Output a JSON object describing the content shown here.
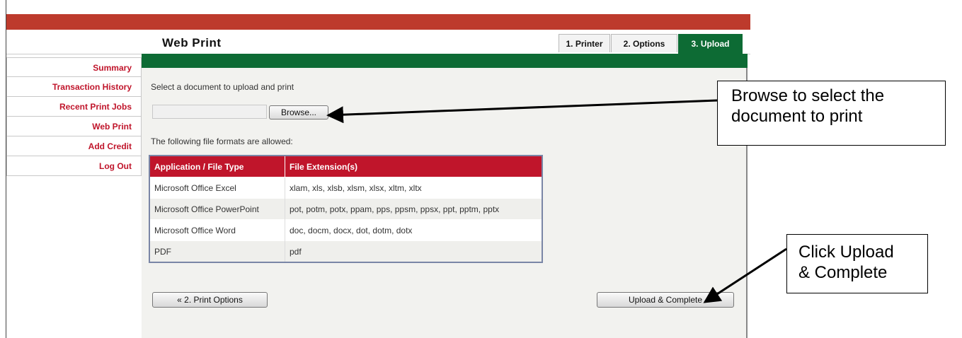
{
  "header": {
    "title": "Web Print",
    "tabs": [
      {
        "label": "1. Printer",
        "active": false
      },
      {
        "label": "2. Options",
        "active": false
      },
      {
        "label": "3. Upload",
        "active": true
      }
    ]
  },
  "sidebar": {
    "items": [
      {
        "label": "Summary"
      },
      {
        "label": "Transaction History"
      },
      {
        "label": "Recent Print Jobs"
      },
      {
        "label": "Web Print"
      },
      {
        "label": "Add Credit"
      },
      {
        "label": "Log Out"
      }
    ]
  },
  "main": {
    "select_prompt": "Select a document to upload and print",
    "browse_label": "Browse...",
    "file_value": "",
    "formats_intro": "The following file formats are allowed:",
    "table": {
      "headers": [
        "Application / File Type",
        "File Extension(s)"
      ],
      "rows": [
        [
          "Microsoft Office Excel",
          "xlam, xls, xlsb, xlsm, xlsx, xltm, xltx"
        ],
        [
          "Microsoft Office PowerPoint",
          "pot, potm, potx, ppam, pps, ppsm, ppsx, ppt, pptm, pptx"
        ],
        [
          "Microsoft Office Word",
          "doc, docm, docx, dot, dotm, dotx"
        ],
        [
          "PDF",
          "pdf"
        ]
      ]
    },
    "back_button": "« 2. Print Options",
    "upload_button": "Upload & Complete"
  },
  "annotations": {
    "browse_note": [
      "Browse to select the",
      "document to print"
    ],
    "upload_note": [
      "Click Upload",
      "& Complete"
    ]
  },
  "colors": {
    "brand_red": "#bd3a2c",
    "brand_green": "#0d6b34",
    "link_red": "#c0152b"
  }
}
